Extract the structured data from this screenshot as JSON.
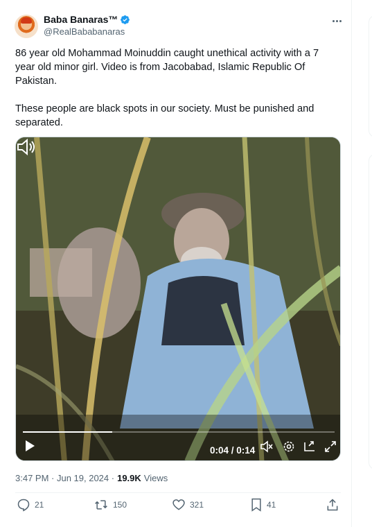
{
  "author": {
    "name": "Baba Banaras™",
    "handle": "@RealBababanaras",
    "verified": true
  },
  "post": {
    "paragraphs": [
      "86 year old Mohammad Moinuddin caught unethical activity with a 7 year old minor girl. Video is from Jacobabad, Islamic Republic Of Pakistan.",
      "These people are black spots in our society. Must be punished and separated."
    ],
    "timestamp": "3:47 PM · Jun 19, 2024 ·",
    "views_count": "19.9K",
    "views_label": "Views"
  },
  "video": {
    "time_display": "0:04 / 0:14",
    "progress": 0.286
  },
  "actions": {
    "replies": "21",
    "reposts": "150",
    "likes": "321",
    "bookmarks": "41"
  },
  "icons": [
    "more-icon",
    "verified-icon",
    "play-icon",
    "mute-icon",
    "settings-icon",
    "pip-icon",
    "fullscreen-icon",
    "volume-icon",
    "reply-icon",
    "repost-icon",
    "like-icon",
    "bookmark-icon",
    "share-icon"
  ],
  "colors": {
    "verified": "#1d9bf0",
    "secondary_text": "#536471",
    "primary_text": "#0f1419"
  }
}
